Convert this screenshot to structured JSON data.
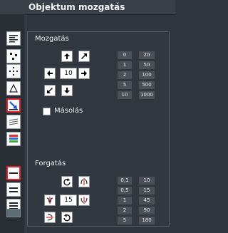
{
  "window": {
    "title": "Objektum mozgatás"
  },
  "toolbar": {
    "tools": [
      {
        "icon": "align-text-icon"
      },
      {
        "icon": "dots-cluster-icon"
      },
      {
        "icon": "dots-ring-icon"
      },
      {
        "icon": "shape-outline-icon"
      },
      {
        "icon": "move-diagonal-icon",
        "selected": true
      },
      {
        "icon": "stripes-icon"
      },
      {
        "icon": "color-bars-icon"
      },
      {
        "icon": "line-red-icon"
      },
      {
        "icon": "lines-double-icon"
      },
      {
        "icon": "lines-triple-icon"
      }
    ],
    "selected_border": "#e2252b"
  },
  "move": {
    "heading": "Mozgatás",
    "step_value": "10",
    "copy_label": "Másolás",
    "copy_checked": false,
    "preset_left": [
      "0",
      "1",
      "2",
      "5",
      "10"
    ],
    "preset_right": [
      "20",
      "50",
      "100",
      "500",
      "1000"
    ]
  },
  "rotate": {
    "heading": "Forgatás",
    "angle_value": "15",
    "preset_left": [
      "0,1",
      "0,5",
      "1",
      "2",
      "5"
    ],
    "preset_right": [
      "10",
      "15",
      "45",
      "90",
      "180"
    ]
  }
}
